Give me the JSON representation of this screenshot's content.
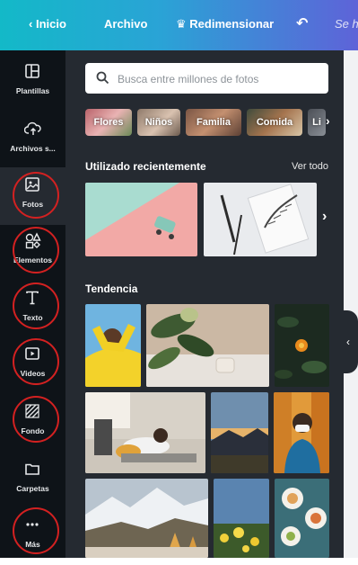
{
  "topbar": {
    "back_label": "Inicio",
    "file_label": "Archivo",
    "resize_label": "Redimensionar",
    "faded_label": "Se h"
  },
  "sidebar": {
    "items": [
      {
        "label": "Plantillas",
        "icon": "layout-icon"
      },
      {
        "label": "Archivos s...",
        "icon": "cloud-upload-icon"
      },
      {
        "label": "Fotos",
        "icon": "photo-icon"
      },
      {
        "label": "Elementos",
        "icon": "shapes-icon"
      },
      {
        "label": "Texto",
        "icon": "text-icon"
      },
      {
        "label": "Videos",
        "icon": "video-icon"
      },
      {
        "label": "Fondo",
        "icon": "background-icon"
      },
      {
        "label": "Carpetas",
        "icon": "folder-icon"
      },
      {
        "label": "Más",
        "icon": "more-icon"
      }
    ],
    "active": "Fotos",
    "highlight_color": "#d32121"
  },
  "panel": {
    "search_placeholder": "Busca entre millones de fotos",
    "chips": [
      "Flores",
      "Niños",
      "Familia",
      "Comida",
      "Li"
    ],
    "recent_title": "Utilizado recientemente",
    "see_all": "Ver todo",
    "trending_title": "Tendencia"
  },
  "colors": {
    "topbar_start": "#13b9c8",
    "topbar_end": "#5e63d8",
    "sidebar_bg": "#0e1318",
    "panel_bg": "#252a31"
  }
}
